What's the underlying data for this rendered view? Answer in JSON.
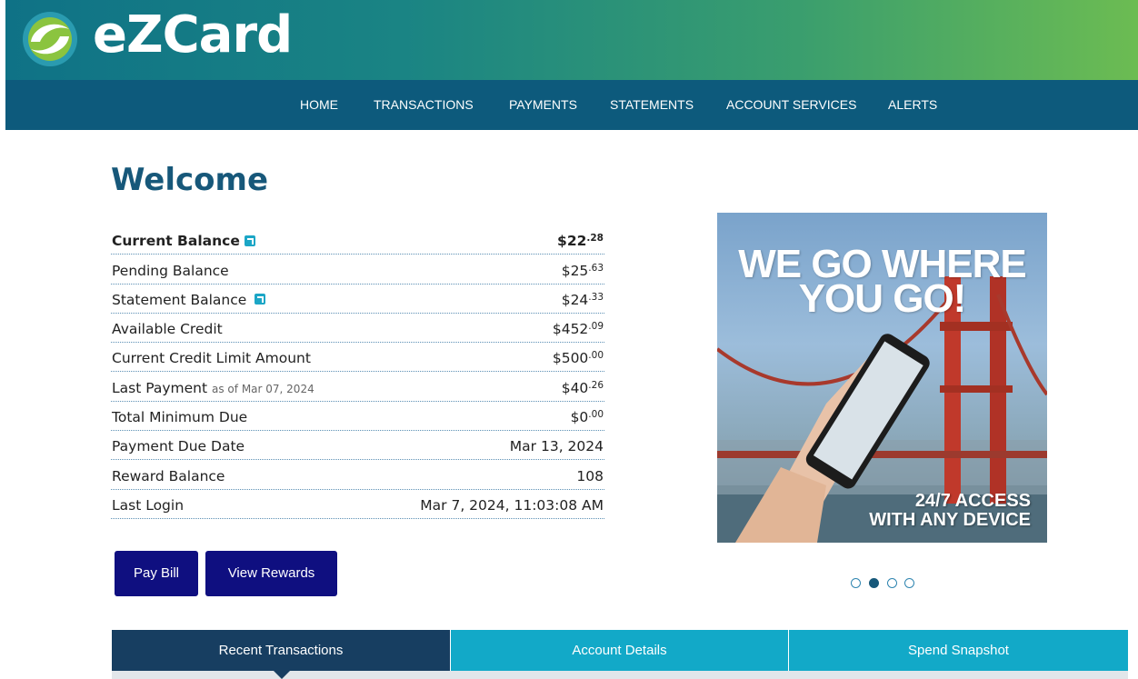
{
  "brand": {
    "name": "eZCard"
  },
  "nav": {
    "items": [
      {
        "label": "HOME"
      },
      {
        "label": "TRANSACTIONS"
      },
      {
        "label": "PAYMENTS"
      },
      {
        "label": "STATEMENTS"
      },
      {
        "label": "ACCOUNT SERVICES"
      },
      {
        "label": "ALERTS"
      }
    ]
  },
  "page": {
    "title": "Welcome"
  },
  "summary": {
    "rows": [
      {
        "label": "Current Balance",
        "dollars": "$22",
        "cents": ".28",
        "has_link_icon": true
      },
      {
        "label": "Pending Balance",
        "dollars": "$25",
        "cents": ".63"
      },
      {
        "label": "Statement Balance",
        "dollars": "$24",
        "cents": ".33",
        "has_link_icon": true
      },
      {
        "label": "Available Credit",
        "dollars": "$452",
        "cents": ".09"
      },
      {
        "label": "Current Credit Limit Amount",
        "dollars": "$500",
        "cents": ".00"
      },
      {
        "label": "Last Payment",
        "sublabel": "as of Mar 07, 2024",
        "dollars": "$40",
        "cents": ".26"
      },
      {
        "label": "Total Minimum Due",
        "dollars": "$0",
        "cents": ".00"
      },
      {
        "label": "Payment Due Date",
        "value": "Mar 13, 2024"
      },
      {
        "label": "Reward Balance",
        "value": "108"
      },
      {
        "label": "Last Login",
        "value": "Mar 7, 2024, 11:03:08 AM"
      }
    ]
  },
  "actions": {
    "pay_bill": "Pay Bill",
    "view_rewards": "View Rewards"
  },
  "promo": {
    "headline_line1": "WE GO WHERE",
    "headline_line2": "YOU GO!",
    "sub_line1": "24/7 ACCESS",
    "sub_line2": "WITH ANY DEVICE",
    "slide_count": 4,
    "active_slide": 2
  },
  "tabs": [
    {
      "label": "Recent Transactions",
      "active": true
    },
    {
      "label": "Account Details",
      "active": false
    },
    {
      "label": "Spend Snapshot",
      "active": false
    }
  ],
  "colors": {
    "nav_bg": "#0d5a7c",
    "title": "#17587a",
    "button_bg": "#0f0f80",
    "tab_active": "#173e61",
    "tab_inactive": "#12a9c8",
    "link_icon": "#1ba6c6"
  },
  "icons": {
    "logo": "ezcard-swirl-logo",
    "row_link": "external-link-icon"
  }
}
